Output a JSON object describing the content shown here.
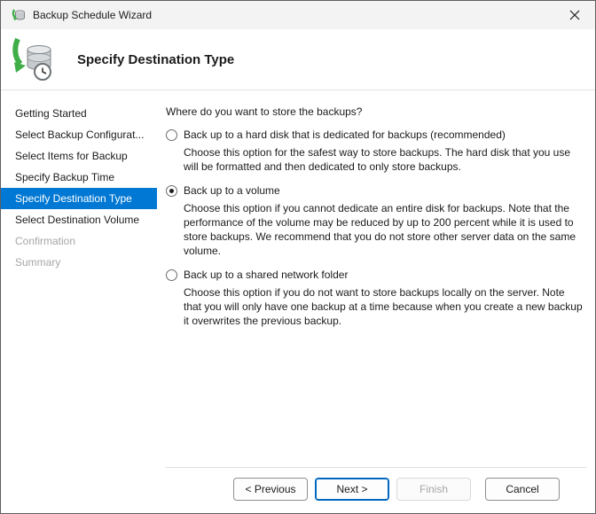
{
  "window": {
    "title": "Backup Schedule Wizard"
  },
  "header": {
    "title": "Specify Destination Type"
  },
  "sidebar": {
    "items": [
      {
        "label": "Getting Started",
        "state": "normal"
      },
      {
        "label": "Select Backup Configurat...",
        "state": "normal"
      },
      {
        "label": "Select Items for Backup",
        "state": "normal"
      },
      {
        "label": "Specify Backup Time",
        "state": "normal"
      },
      {
        "label": "Specify Destination Type",
        "state": "selected"
      },
      {
        "label": "Select Destination Volume",
        "state": "normal"
      },
      {
        "label": "Confirmation",
        "state": "disabled"
      },
      {
        "label": "Summary",
        "state": "disabled"
      }
    ]
  },
  "main": {
    "question": "Where do you want to store the backups?",
    "options": [
      {
        "label": "Back up to a hard disk that is dedicated for backups (recommended)",
        "selected": false,
        "description": "Choose this option for the safest way to store backups. The hard disk that you use will be formatted and then dedicated to only store backups."
      },
      {
        "label": "Back up to a volume",
        "selected": true,
        "description": "Choose this option if you cannot dedicate an entire disk for backups. Note that the performance of the volume may be reduced by up to 200 percent while it is used to store backups. We recommend that you do not store other server data on the same volume."
      },
      {
        "label": "Back up to a shared network folder",
        "selected": false,
        "description": "Choose this option if you do not want to store backups locally on the server. Note that you will only have one backup at a time because when you create a new backup it overwrites the previous backup."
      }
    ]
  },
  "footer": {
    "buttons": [
      {
        "label": "< Previous",
        "state": "normal"
      },
      {
        "label": "Next >",
        "state": "default"
      },
      {
        "label": "Finish",
        "state": "disabled"
      },
      {
        "label": "Cancel",
        "state": "normal"
      }
    ]
  },
  "icons": {
    "titlebar": "backup-app-icon",
    "header": "backup-disks-clock-icon",
    "close": "close-icon"
  },
  "colors": {
    "accent": "#0078d4",
    "default_button_border": "#0067c0",
    "disabled_text": "#a6a6a6"
  }
}
